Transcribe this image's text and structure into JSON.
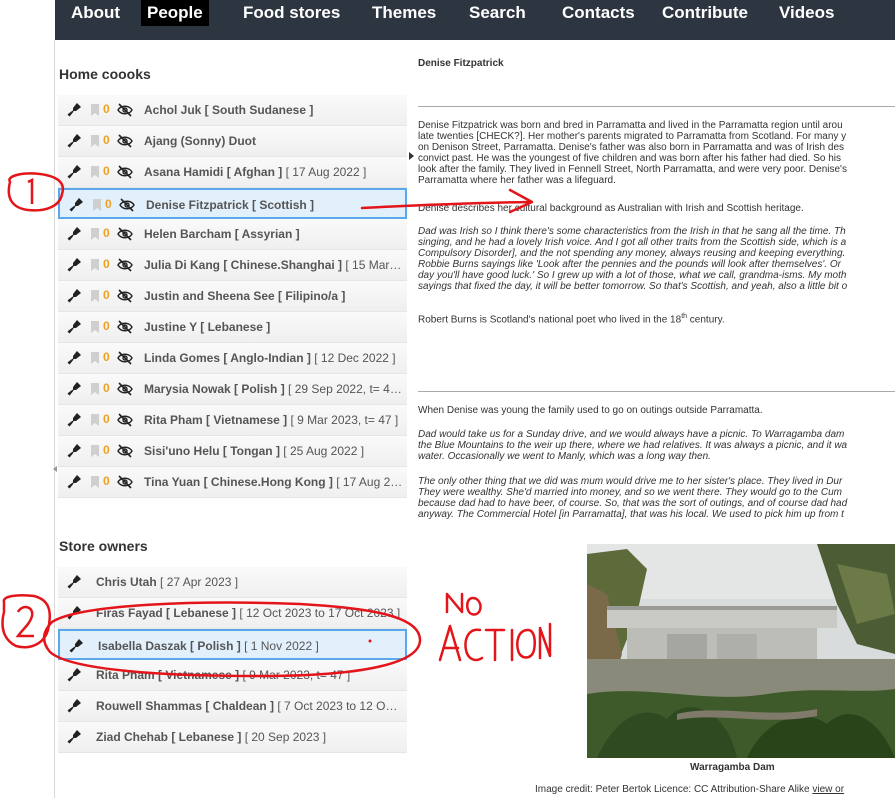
{
  "nav": [
    {
      "label": "About",
      "active": false
    },
    {
      "label": "People",
      "active": true
    },
    {
      "label": "Food stores",
      "active": false
    },
    {
      "label": "Themes",
      "active": false
    },
    {
      "label": "Search",
      "active": false
    },
    {
      "label": "Contacts",
      "active": false
    },
    {
      "label": "Contribute",
      "active": false
    },
    {
      "label": "Videos",
      "active": false
    }
  ],
  "sections": {
    "home_cooks": "Home coooks",
    "store_owners": "Store owners"
  },
  "home_cooks": [
    {
      "name": "Achol Juk [ South Sudanese ]",
      "extra": "",
      "count": "0"
    },
    {
      "name": "Ajang (Sonny) Duot",
      "extra": "",
      "count": "0"
    },
    {
      "name": "Asana Hamidi [ Afghan ]",
      "extra": " [ 17 Aug 2022 ]",
      "count": "0"
    },
    {
      "name": "Denise Fitzpatrick [ Scottish ]",
      "extra": "",
      "count": "0",
      "selected": true
    },
    {
      "name": "Helen Barcham [ Assyrian ]",
      "extra": "",
      "count": "0"
    },
    {
      "name": "Julia Di Kang [ Chinese.Shanghai ]",
      "extra": " [ 15 Mar…",
      "count": "0"
    },
    {
      "name": "Justin and Sheena See [ Filipino/a ]",
      "extra": "",
      "count": "0"
    },
    {
      "name": "Justine Y [ Lebanese ]",
      "extra": "",
      "count": "0"
    },
    {
      "name": "Linda Gomes [ Anglo-Indian ]",
      "extra": " [ 12 Dec 2022 ]",
      "count": "0"
    },
    {
      "name": "Marysia Nowak [ Polish ]",
      "extra": " [ 29 Sep 2022, t= 46 ]",
      "count": "0"
    },
    {
      "name": "Rita Pham [ Vietnamese ]",
      "extra": " [ 9 Mar 2023, t= 47 ]",
      "count": "0"
    },
    {
      "name": "Sisi'uno Helu [ Tongan ]",
      "extra": " [ 25 Aug 2022 ]",
      "count": "0"
    },
    {
      "name": "Tina Yuan [ Chinese.Hong Kong ]",
      "extra": " [ 17 Aug 2…",
      "count": "0"
    }
  ],
  "store_owners": [
    {
      "name": "Chris Utah",
      "extra": " [ 27 Apr 2023 ]"
    },
    {
      "name": "Firas Fayad [ Lebanese ]",
      "extra": " [ 12 Oct 2023 to 17 Oct 2023 ]"
    },
    {
      "name": "Isabella Daszak [ Polish ]",
      "extra": " [ 1 Nov 2022 ]",
      "selected": true
    },
    {
      "name": "Rita Pham [ Vietnamese ]",
      "extra": " [ 9 Mar 2023, t= 47 ]"
    },
    {
      "name": "Rouwell Shammas [ Chaldean ]",
      "extra": " [ 7 Oct 2023 to 12 Oc…"
    },
    {
      "name": "Ziad Chehab [ Lebanese ]",
      "extra": " [ 20 Sep 2023 ]"
    }
  ],
  "article": {
    "title": "Denise Fitzpatrick",
    "p1": [
      "Denise Fitzpatrick was born and bred in Parramatta and lived in the Parramatta region until arou",
      "late twenties [CHECK?]. Her mother's parents migrated to Parramatta from Scotland. For many y",
      "on Denison Street, Parramatta. Denise's father was also born in Parramatta and was of Irish des",
      "convict past. He was the youngest of five children and was born after his father had died. So his",
      "look after the family. They lived in Fennell Street, North Parramatta, and were very poor. Denise's",
      "Parramatta where her father was a lifeguard."
    ],
    "p2": "Denise describes her cultural background as Australian with Irish and Scottish heritage.",
    "p3": [
      "Dad was Irish so I think there's some characteristics from the Irish in that he sang all the time. Th",
      "singing, and he had a lovely Irish voice. And I got all other traits from the Scottish side, which is a",
      "Compulsory Disorder], and the not spending any money, always reusing and keeping everything.",
      "Robbie Burns sayings like 'Look after the pennies and the pounds will look after themselves'. Or",
      "day you'll have good luck.' So I grew up with a lot of those, what we call, grandma-isms. My moth",
      "sayings that fixed the day, it will be better tomorrow. So that's Scottish, and yeah, also a little bit o"
    ],
    "p4_pre": "Robert Burns is Scotland's national poet who lived in the 18",
    "p4_sup": "th",
    "p4_post": " century.",
    "p5": "When Denise was young the family used to go on outings outside Parramatta.",
    "p6": [
      "Dad would take us for a Sunday drive, and we would always have a picnic. To Warragamba dam",
      "the Blue Mountains to the weir up there, where we had relatives. It was always a picnic, and it wa",
      "water. Occasionally we went to Manly, which was a long way then."
    ],
    "p7": [
      "The only other thing that we did was mum would drive me to her sister's place.  They lived in Dur",
      "They were wealthy.  She'd married into money, and so we went there. They would go to the Cum",
      "because dad had to have beer, of course. So, that was the sort of outings, and of course dad had",
      "anyway. The Commercial Hotel [in Parramatta], that was his local. We used to pick him up from t"
    ],
    "photo_caption": "Warragamba Dam",
    "credit_text": "Image credit: Peter Bertok   Licence: CC Attribution-Share Alike",
    "credit_link": "view or"
  },
  "annotations": {
    "mark1": "1",
    "mark2": "2",
    "note_line1": "NO",
    "note_line2": "ACTION"
  },
  "colors": {
    "nav_bg": "#2d3640",
    "selected_border": "#5aa7ea",
    "selected_bg": "#e2f0fc",
    "count_orange": "#f0a020",
    "annotation_red": "#e3151a"
  }
}
